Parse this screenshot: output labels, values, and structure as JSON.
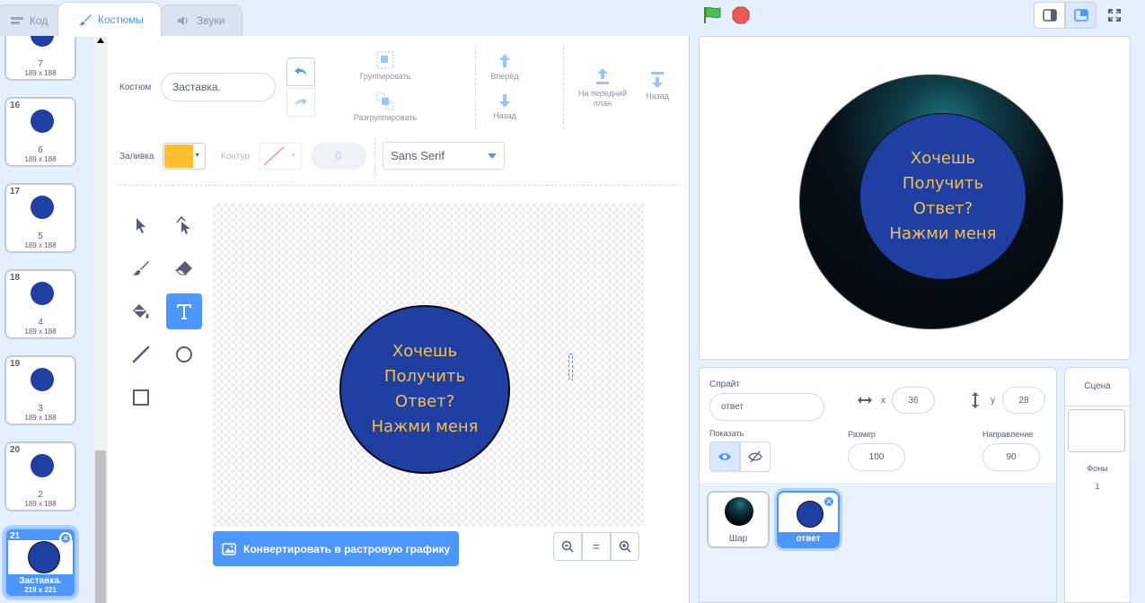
{
  "tabs": [
    {
      "label": "Код",
      "icon": "code-icon"
    },
    {
      "label": "Костюмы",
      "icon": "brush-icon"
    },
    {
      "label": "Звуки",
      "icon": "speaker-icon"
    }
  ],
  "costumes": [
    {
      "number": "",
      "name": "7",
      "size": "189 x 188"
    },
    {
      "number": "16",
      "name": "6",
      "size": "189 x 188"
    },
    {
      "number": "17",
      "name": "5",
      "size": "189 x 188"
    },
    {
      "number": "18",
      "name": "4",
      "size": "189 x 188"
    },
    {
      "number": "19",
      "name": "3",
      "size": "189 x 188"
    },
    {
      "number": "20",
      "name": "2",
      "size": "189 x 188"
    },
    {
      "number": "21",
      "name": "Заставка.",
      "size": "219 x 221"
    }
  ],
  "editor": {
    "costume_label": "Костюм",
    "costume_name": "Заставка.",
    "group_label": "Группировать",
    "ungroup_label": "Разгруппировать",
    "forward_label": "Вперёд",
    "backward_label": "Назад",
    "front_label": "На передний план",
    "back_label": "Назад",
    "fill_label": "Заливка",
    "fill_color": "#ffbf2f",
    "outline_label": "Контур",
    "outline_width": "0",
    "font": "Sans Serif",
    "convert_label": "Конвертировать в растровую графику",
    "zoom_equal": "="
  },
  "ball_text": [
    "Хочешь",
    "Получить",
    "Ответ?",
    "Нажми меня"
  ],
  "sprite": {
    "label": "Спрайт",
    "name": "ответ",
    "x_label": "x",
    "x": "36",
    "y_label": "y",
    "y": "28",
    "show_label": "Показать",
    "size_label": "Размер",
    "size": "100",
    "direction_label": "Направление",
    "direction": "90"
  },
  "sprites": [
    {
      "name": "Шар"
    },
    {
      "name": "ответ"
    }
  ],
  "scene": {
    "title": "Сцена",
    "backdrops_label": "Фоны",
    "backdrops_count": "1"
  },
  "colors": {
    "accent": "#4c97ff",
    "ball_blue": "#203fa3",
    "text_gold": "#f4c04c"
  }
}
